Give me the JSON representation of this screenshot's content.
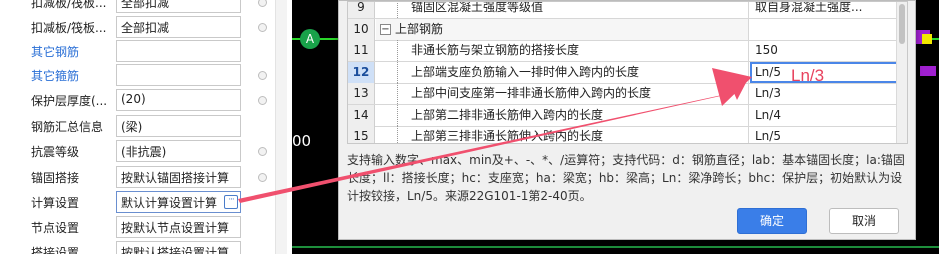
{
  "property_panel": {
    "rows": [
      {
        "label": "扣减板/筏板...",
        "value": "全部扣减",
        "blue": false
      },
      {
        "label": "扣减板/筏板...",
        "value": "全部扣减",
        "blue": false
      },
      {
        "label": "其它钢筋",
        "value": "",
        "blue": true
      },
      {
        "label": "其它箍筋",
        "value": "",
        "blue": true
      },
      {
        "label": "保护层厚度(...",
        "value": "(20)",
        "blue": false
      },
      {
        "label": "钢筋汇总信息",
        "value": "(梁)",
        "blue": false
      },
      {
        "label": "抗震等级",
        "value": "(非抗震)",
        "blue": false
      },
      {
        "label": "锚固搭接",
        "value": "按默认锚固搭接计算",
        "blue": false
      },
      {
        "label": "计算设置",
        "value": "默认计算设置计算",
        "blue": false
      },
      {
        "label": "节点设置",
        "value": "按默认节点设置计算",
        "blue": false
      },
      {
        "label": "搭接设置",
        "value": "按默认搭接设置计算",
        "blue": false
      }
    ],
    "ellipsis_label": "···"
  },
  "canvas": {
    "axis_marker": "A",
    "left_number": "00",
    "colors": {
      "background": "#000000",
      "green_line": "#2ad62a",
      "purple": "#a020d0",
      "yellow": "#f2e800"
    }
  },
  "dialog": {
    "grid_rows": [
      {
        "num": "9",
        "name": "锚固区混凝土强度等级值",
        "value": "取自身混凝土强度...",
        "indent": true,
        "group": false,
        "selected": false
      },
      {
        "num": "10",
        "name": "上部钢筋",
        "value": "",
        "indent": false,
        "group": true,
        "selected": false,
        "toggle": "−"
      },
      {
        "num": "11",
        "name": "非通长筋与架立钢筋的搭接长度",
        "value": "150",
        "indent": true,
        "group": false,
        "selected": false
      },
      {
        "num": "12",
        "name": "上部端支座负筋输入一排时伸入跨内的长度",
        "value": "Ln/5",
        "indent": true,
        "group": false,
        "selected": true
      },
      {
        "num": "13",
        "name": "上部中间支座第一排非通长筋伸入跨内的长度",
        "value": "Ln/3",
        "indent": true,
        "group": false,
        "selected": false
      },
      {
        "num": "14",
        "name": "上部第二排非通长筋伸入跨内的长度",
        "value": "Ln/4",
        "indent": true,
        "group": false,
        "selected": false
      },
      {
        "num": "15",
        "name": "上部第三排非通长筋伸入跨内的长度",
        "value": "Ln/5",
        "indent": true,
        "group": false,
        "selected": false
      }
    ],
    "hint": "支持输入数字、max、min及+、-、*、/运算符；支持代码：d：钢筋直径；lab：基本锚固长度；la:锚固长度；ll：搭接长度；hc：支座宽；ha：梁宽；hb：梁高；Ln：梁净跨长；bhc：保护层；初始默认为设计按铰接，Ln/5。来源22G101-1第2-40页。",
    "ok_label": "确定",
    "cancel_label": "取消",
    "accent_color": "#3a7ee8"
  },
  "annotation": {
    "text": "Ln/3",
    "color": "#e8425e"
  }
}
